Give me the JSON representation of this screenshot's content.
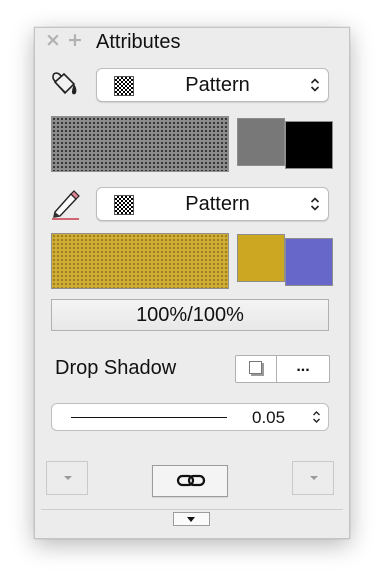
{
  "window": {
    "title": "Attributes",
    "close_icon": "close-icon",
    "add_icon": "plus-icon"
  },
  "fill": {
    "icon": "paint-bucket-icon",
    "pattern_label": "Pattern",
    "foreground_color": "#787878",
    "background_color": "#000000",
    "preview_color": "#8c8c8c"
  },
  "pen": {
    "icon": "pencil-icon",
    "pattern_label": "Pattern",
    "foreground_color": "#cca822",
    "background_color": "#6767c9",
    "preview_color": "#d0ad34"
  },
  "opacity": {
    "label": "100%/100%"
  },
  "drop_shadow": {
    "label": "Drop Shadow",
    "options_label": "..."
  },
  "line_weight": {
    "value": "0.05"
  },
  "footer": {
    "left_menu_icon": "triangle-down-icon",
    "link_icon": "link-chain-icon",
    "right_menu_icon": "triangle-down-icon",
    "disclosure_icon": "triangle-down-icon"
  }
}
